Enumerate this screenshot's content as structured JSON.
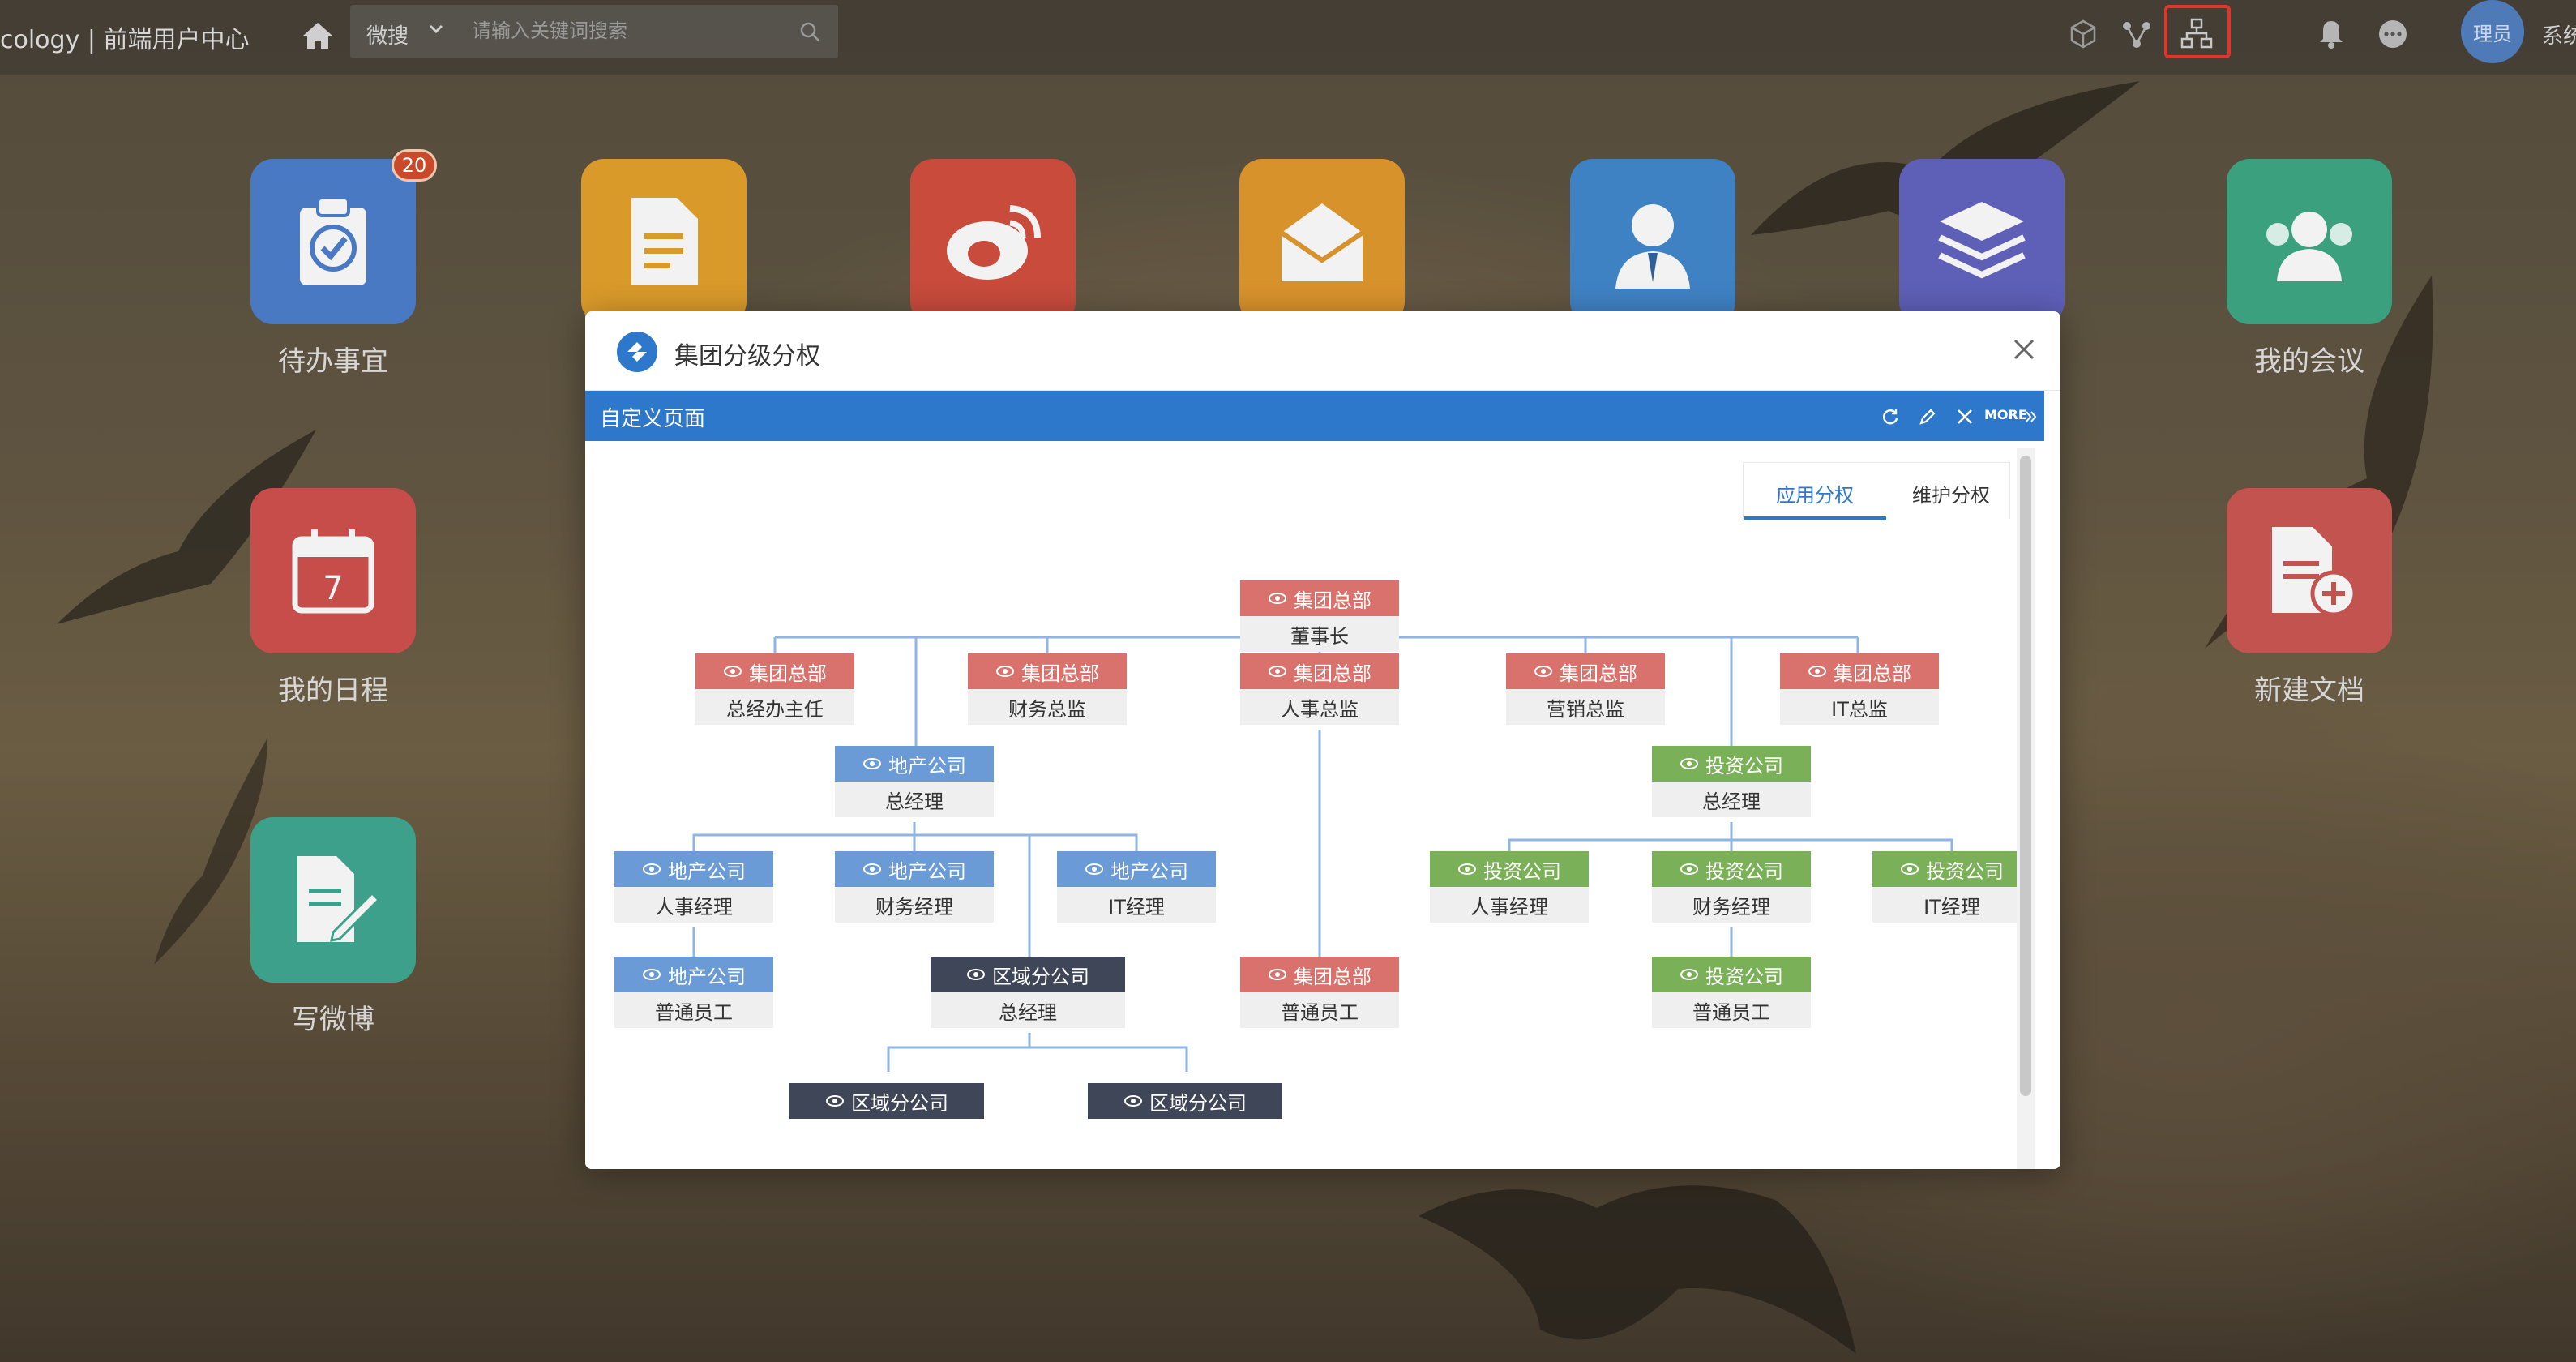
{
  "topbar": {
    "brand": "cology | 前端用户中心",
    "search_scope": "微搜",
    "search_placeholder": "请输入关键词搜索",
    "avatar_text": "理员",
    "sys_text": "系统"
  },
  "desktop": {
    "apps": [
      {
        "label": "待办事宜",
        "badge": "20",
        "color": "#4a79c4"
      },
      {
        "label": "",
        "color": "#d99a2a"
      },
      {
        "label": "",
        "color": "#c84b3c"
      },
      {
        "label": "",
        "color": "#d8922c"
      },
      {
        "label": "",
        "color": "#3f82c4"
      },
      {
        "label": "",
        "color": "#5e5fb7"
      },
      {
        "label": "我的会议",
        "color": "#3aa07e"
      },
      {
        "label": "我的日程",
        "color": "#c74d4a"
      },
      {
        "label": "新建文档",
        "color": "#c2534e"
      },
      {
        "label": "写微博",
        "color": "#3da08a"
      }
    ]
  },
  "modal": {
    "title": "集团分级分权",
    "portal_title": "自定义页面",
    "more": "MORE",
    "tabs": [
      {
        "label": "应用分权",
        "active": true
      },
      {
        "label": "维护分权",
        "active": false
      }
    ]
  },
  "org_chart": {
    "nodes": [
      {
        "id": "root",
        "org": "集团总部",
        "title": "董事长",
        "color": "#d9716c"
      },
      {
        "id": "g1",
        "org": "集团总部",
        "title": "总经办主任",
        "color": "#d9716c"
      },
      {
        "id": "g2",
        "org": "集团总部",
        "title": "财务总监",
        "color": "#d9716c"
      },
      {
        "id": "g3",
        "org": "集团总部",
        "title": "人事总监",
        "color": "#d9716c"
      },
      {
        "id": "g4",
        "org": "集团总部",
        "title": "营销总监",
        "color": "#d9716c"
      },
      {
        "id": "g5",
        "org": "集团总部",
        "title": "IT总监",
        "color": "#d9716c"
      },
      {
        "id": "re_gm",
        "org": "地产公司",
        "title": "总经理",
        "color": "#6a9bd6"
      },
      {
        "id": "inv_gm",
        "org": "投资公司",
        "title": "总经理",
        "color": "#7ab058"
      },
      {
        "id": "re_hr",
        "org": "地产公司",
        "title": "人事经理",
        "color": "#6a9bd6"
      },
      {
        "id": "re_fin",
        "org": "地产公司",
        "title": "财务经理",
        "color": "#6a9bd6"
      },
      {
        "id": "re_it",
        "org": "地产公司",
        "title": "IT经理",
        "color": "#6a9bd6"
      },
      {
        "id": "re_staff",
        "org": "地产公司",
        "title": "普通员工",
        "color": "#6a9bd6"
      },
      {
        "id": "reg_gm",
        "org": "区域分公司",
        "title": "总经理",
        "color": "#3e4657"
      },
      {
        "id": "g_staff",
        "org": "集团总部",
        "title": "普通员工",
        "color": "#d9716c"
      },
      {
        "id": "inv_hr",
        "org": "投资公司",
        "title": "人事经理",
        "color": "#7ab058"
      },
      {
        "id": "inv_fin",
        "org": "投资公司",
        "title": "财务经理",
        "color": "#7ab058"
      },
      {
        "id": "inv_it",
        "org": "投资公司",
        "title": "IT经理",
        "color": "#7ab058"
      },
      {
        "id": "inv_staff",
        "org": "投资公司",
        "title": "普通员工",
        "color": "#7ab058"
      },
      {
        "id": "reg1",
        "org": "区域分公司",
        "title": "",
        "color": "#3e4657"
      },
      {
        "id": "reg2",
        "org": "区域分公司",
        "title": "",
        "color": "#3e4657"
      }
    ]
  }
}
